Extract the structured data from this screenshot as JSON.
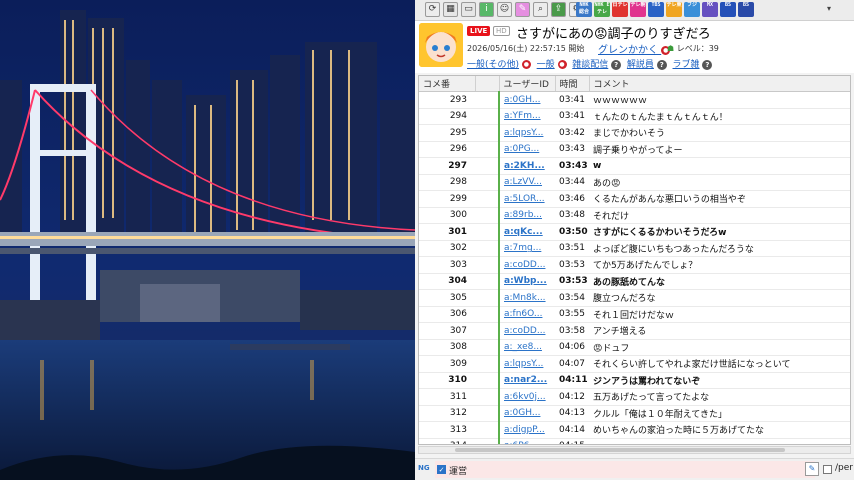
{
  "toolbar": {
    "channels": [
      {
        "label": "NHK 総合",
        "color": "#3a78c8"
      },
      {
        "label": "NHK Eテレ",
        "color": "#48a848"
      },
      {
        "label": "日テレ",
        "color": "#e0332f"
      },
      {
        "label": "テレ朝",
        "color": "#e0338e"
      },
      {
        "label": "TBS",
        "color": "#2a62c6"
      },
      {
        "label": "テレ東",
        "color": "#f0a521"
      },
      {
        "label": "フジ",
        "color": "#3a8fd8"
      },
      {
        "label": "MX",
        "color": "#6650c0"
      },
      {
        "label": "BS",
        "color": "#2450b8"
      },
      {
        "label": "BS",
        "color": "#2a4aa8"
      }
    ]
  },
  "stream": {
    "live_badge": "LIVE",
    "hd_badge": "HD",
    "title": "さすがにあの😡調子のりすぎだろ",
    "start_time": "2026/05/16(土) 22:57:15 開始",
    "owner": "グレンかかく",
    "level": "レベル：39",
    "links": [
      "一般(その他)",
      "一般",
      "雑談配信",
      "解説員",
      "ラブ雑"
    ]
  },
  "comments": {
    "columns": [
      "コメ番",
      "",
      "ユーザーID",
      "時間",
      "コメント"
    ],
    "rows": [
      {
        "no": "293",
        "uid": "a:0GH...",
        "time": "03:41",
        "text": "ｗｗｗｗｗｗ",
        "bold": false
      },
      {
        "no": "294",
        "uid": "a:YFm...",
        "time": "03:41",
        "text": "ｔんたのｔんたまｔんｔんｔん！",
        "bold": false
      },
      {
        "no": "295",
        "uid": "a:lqpsY...",
        "time": "03:42",
        "text": "まじでかわいそう",
        "bold": false
      },
      {
        "no": "296",
        "uid": "a:0PG...",
        "time": "03:43",
        "text": "調子乗りやがってよー",
        "bold": false
      },
      {
        "no": "297",
        "uid": "a:2KH...",
        "time": "03:43",
        "text": "w",
        "bold": true
      },
      {
        "no": "298",
        "uid": "a:LzVV...",
        "time": "03:44",
        "text": "あの😡",
        "bold": false
      },
      {
        "no": "299",
        "uid": "a:5LOR...",
        "time": "03:46",
        "text": "くるたんがあんな悪口いうの相当やぞ",
        "bold": false
      },
      {
        "no": "300",
        "uid": "a:89rb...",
        "time": "03:48",
        "text": "それだけ",
        "bold": false
      },
      {
        "no": "301",
        "uid": "a:qKc...",
        "time": "03:50",
        "text": "さすがにくるるかわいそうだろw",
        "bold": true
      },
      {
        "no": "302",
        "uid": "a:7mg...",
        "time": "03:51",
        "text": "よっぽど腹にいちもつあったんだろうな",
        "bold": false
      },
      {
        "no": "303",
        "uid": "a:coDD...",
        "time": "03:53",
        "text": "てか5万あげたんでしょ？",
        "bold": false
      },
      {
        "no": "304",
        "uid": "a:Wbp...",
        "time": "03:53",
        "text": "あの豚舐めてんな",
        "bold": true
      },
      {
        "no": "305",
        "uid": "a:Mn8k...",
        "time": "03:54",
        "text": "腹立つんだろな",
        "bold": false
      },
      {
        "no": "306",
        "uid": "a:fn6O...",
        "time": "03:55",
        "text": "それ１回だけだなｗ",
        "bold": false
      },
      {
        "no": "307",
        "uid": "a:coDD...",
        "time": "03:58",
        "text": "アンチ増える",
        "bold": false
      },
      {
        "no": "308",
        "uid": "a:_xe8...",
        "time": "04:06",
        "text": "😡ドュフ",
        "bold": false
      },
      {
        "no": "309",
        "uid": "a:lqpsY...",
        "time": "04:07",
        "text": "それくらい許してやれよ家だけ世話になっといて",
        "bold": false
      },
      {
        "no": "310",
        "uid": "a:nar2...",
        "time": "04:11",
        "text": "ジンアうは罵われてないぞ",
        "bold": true
      },
      {
        "no": "311",
        "uid": "a:6kv0j...",
        "time": "04:12",
        "text": "五万あげたって言ってたよな",
        "bold": false
      },
      {
        "no": "312",
        "uid": "a:0GH...",
        "time": "04:13",
        "text": "クルル「俺は１０年耐えてきた」",
        "bold": false
      },
      {
        "no": "313",
        "uid": "a:digpP...",
        "time": "04:14",
        "text": "めいちゃんの家泊った時に５万あげてたな",
        "bold": false
      },
      {
        "no": "314",
        "uid": "a:6P6...",
        "time": "04:15",
        "text": "ｗｗｗｗ",
        "bold": false
      }
    ]
  },
  "bottom": {
    "ng_label": "NG",
    "admin_label": "運営",
    "right_label": "/per"
  },
  "colors": {
    "accent_link": "#1a5fc0",
    "live": "#e8121a",
    "marker": "#5ab04a"
  }
}
